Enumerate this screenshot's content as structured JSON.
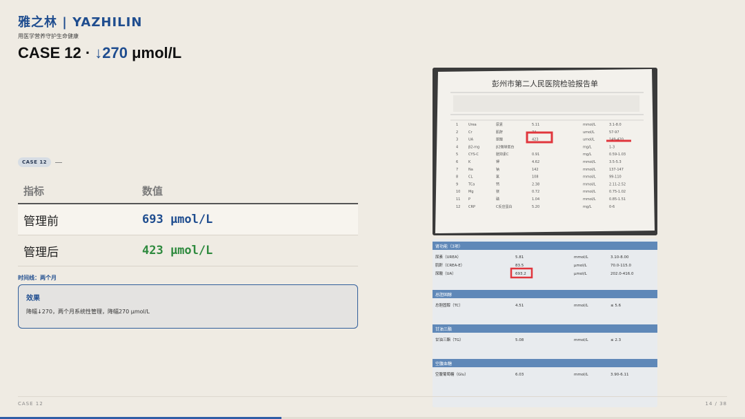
{
  "header": {
    "brand": "雅之林 | YAZHILIN",
    "tagline": "用医学营养守护生命健康",
    "title_prefix": "CASE 12 · ",
    "title_accent": "↓270",
    "title_suffix": " μmol/L"
  },
  "case_badge": "CASE 12",
  "table": {
    "headers": [
      "指标",
      "数值"
    ],
    "rows": [
      {
        "label": "管理前",
        "value": "693 μmol/L"
      },
      {
        "label": "管理后",
        "value": "423 μmol/L"
      }
    ]
  },
  "timeline": "时间线：两个月",
  "effect": {
    "title": "效果",
    "text": "降幅↓270，两个月系统性管理，降幅270 μmol/L"
  },
  "report1": {
    "title": "彭州市第二人民医院检验报告单",
    "highlight_value": "423",
    "ref_range": "149-420",
    "rows": [
      [
        "1",
        "Urea",
        "尿素",
        "5.11",
        "mmol/L",
        "3.1-8.0"
      ],
      [
        "2",
        "Cr",
        "肌酐",
        "74",
        "umol/L",
        "57-97"
      ],
      [
        "3",
        "UA",
        "尿酸",
        "423",
        "umol/L",
        "149-420"
      ],
      [
        "4",
        "β2-mg",
        "β2微球蛋白",
        "",
        "mg/L",
        "1-3"
      ],
      [
        "5",
        "CYS-C",
        "胱抑素C",
        "0.91",
        "mg/L",
        "0.59-1.03"
      ],
      [
        "6",
        "K",
        "钾",
        "4.62",
        "mmol/L",
        "3.5-5.3"
      ],
      [
        "7",
        "Na",
        "钠",
        "142",
        "mmol/L",
        "137-147"
      ],
      [
        "8",
        "CL",
        "氯",
        "108",
        "mmol/L",
        "99-110"
      ],
      [
        "9",
        "TCa",
        "钙",
        "2.38",
        "mmol/L",
        "2.11-2.52"
      ],
      [
        "10",
        "Mg",
        "镁",
        "0.72",
        "mmol/L",
        "0.75-1.02"
      ],
      [
        "11",
        "P",
        "磷",
        "1.04",
        "mmol/L",
        "0.85-1.51"
      ],
      [
        "12",
        "CRP",
        "C反应蛋白",
        "5.20",
        "mg/L",
        "0-6"
      ]
    ]
  },
  "report2": {
    "highlight_value": "693.2",
    "sections": [
      {
        "name": "肾功能（3项）",
        "rows": [
          [
            "尿素（UREA）",
            "5.81",
            "mmol/L",
            "3.10-8.00"
          ],
          [
            "肌酐（CREA-E）",
            "83.5",
            "μmol/L",
            "70.0-115.0"
          ],
          [
            "尿酸（UA）",
            "693.2",
            "μmol/L",
            "202.0-416.0"
          ]
        ]
      },
      {
        "name": "总胆固醇",
        "rows": [
          [
            "总胆固醇（TC）",
            "4.51",
            "mmol/L",
            "≤ 5.6"
          ]
        ]
      },
      {
        "name": "甘油三酯",
        "rows": [
          [
            "甘油三酯（TG）",
            "5.08",
            "mmol/L",
            "≤ 2.3"
          ]
        ]
      },
      {
        "name": "空腹血糖",
        "rows": [
          [
            "空腹葡萄糖（Glu）",
            "6.03",
            "mmol/L",
            "3.90-6.11"
          ]
        ]
      }
    ]
  },
  "footer": {
    "left": "CASE 12",
    "right": "14 / 38",
    "progress": 0.378
  },
  "colors": {
    "brand": "#1f4d8f",
    "after": "#2e8a3e",
    "background": "#efebe3"
  }
}
